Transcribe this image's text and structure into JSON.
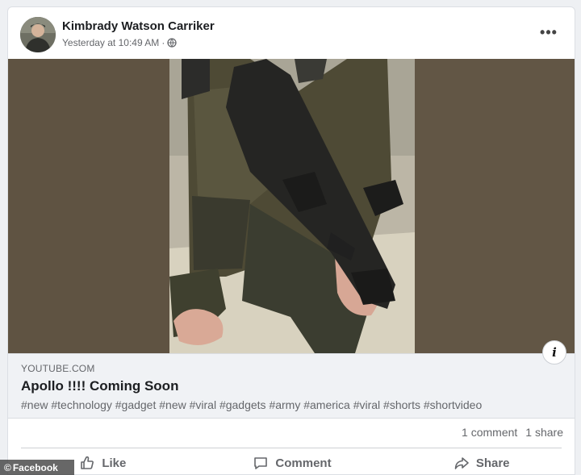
{
  "post": {
    "author": "Kimbrady Watson Carriker",
    "timestamp": "Yesterday at 10:49 AM",
    "separator": "·",
    "privacy_icon": "globe-icon",
    "more_label": "•••"
  },
  "link_preview": {
    "domain": "YOUTUBE.COM",
    "title": "Apollo !!!! Coming Soon",
    "hashtags": "#new #technology #gadget #new #viral #gadgets #army #america #viral #shorts #shortvideo",
    "info_label": "i"
  },
  "stats": {
    "comments": "1 comment",
    "shares": "1 share"
  },
  "actions": {
    "like": "Like",
    "comment": "Comment",
    "share": "Share"
  },
  "watermark": {
    "symbol": "©",
    "text": "Facebook"
  },
  "colors": {
    "media_background": "#615442",
    "link_box": "#f0f2f5",
    "secondary_text": "#65676b"
  }
}
